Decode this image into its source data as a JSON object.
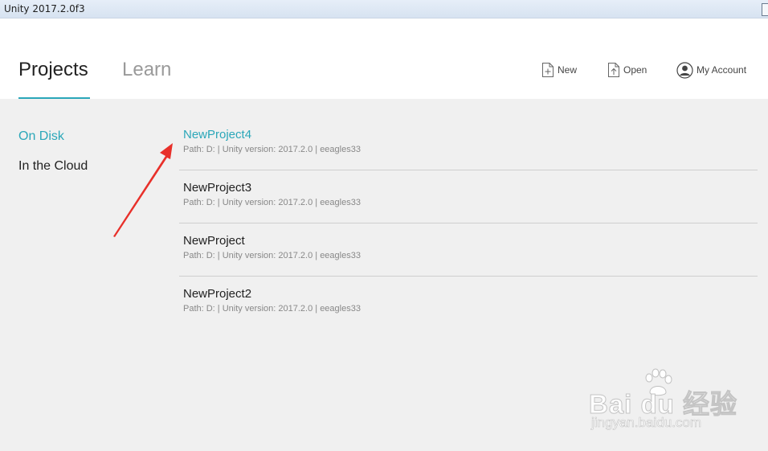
{
  "window": {
    "title": "Unity 2017.2.0f3"
  },
  "header": {
    "tabs": [
      {
        "label": "Projects",
        "active": true
      },
      {
        "label": "Learn",
        "active": false
      }
    ],
    "buttons": {
      "new_label": "New",
      "open_label": "Open",
      "account_label": "My Account"
    }
  },
  "sidebar": {
    "items": [
      {
        "label": "On Disk",
        "active": true
      },
      {
        "label": "In the Cloud",
        "active": false
      }
    ]
  },
  "projects": [
    {
      "name": "NewProject4",
      "meta": "Path: D: | Unity version: 2017.2.0 | eeagles33",
      "selected": true
    },
    {
      "name": "NewProject3",
      "meta": "Path: D: | Unity version: 2017.2.0 | eeagles33",
      "selected": false
    },
    {
      "name": "NewProject",
      "meta": "Path: D: | Unity version: 2017.2.0 | eeagles33",
      "selected": false
    },
    {
      "name": "NewProject2",
      "meta": "Path: D: | Unity version: 2017.2.0 | eeagles33",
      "selected": false
    }
  ],
  "watermark": {
    "brand_text": "Bai du 经验",
    "url_text": "jingyan.baidu.com"
  },
  "colors": {
    "accent": "#2ba7b9",
    "annotation_arrow": "#e8302a"
  },
  "icons": {
    "new": "new-file-icon",
    "open": "open-file-icon",
    "account": "account-avatar-icon",
    "watermark": "paw-icon"
  }
}
